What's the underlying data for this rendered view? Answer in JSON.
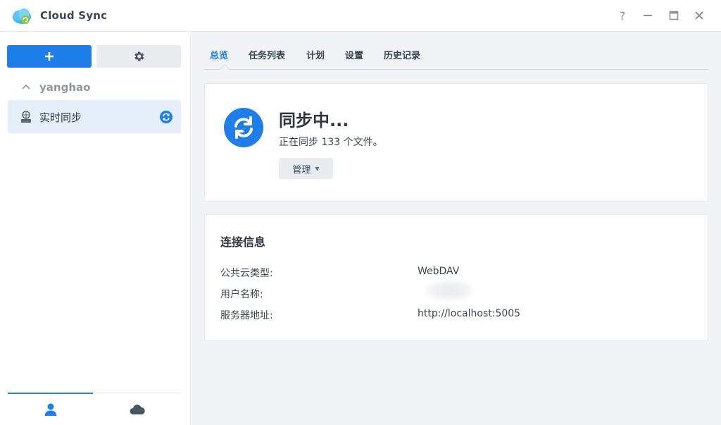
{
  "app": {
    "title": "Cloud Sync",
    "help_glyph": "?"
  },
  "sidebar": {
    "account_name": "yanghao",
    "task_label": "实时同步"
  },
  "tabs": [
    {
      "label": "总览",
      "active": true
    },
    {
      "label": "任务列表",
      "active": false
    },
    {
      "label": "计划",
      "active": false
    },
    {
      "label": "设置",
      "active": false
    },
    {
      "label": "历史记录",
      "active": false
    }
  ],
  "status": {
    "title": "同步中...",
    "description": "正在同步 133 个文件。",
    "manage_label": "管理"
  },
  "connection": {
    "title": "连接信息",
    "rows": [
      {
        "label": "公共云类型:",
        "value": "WebDAV"
      },
      {
        "label": "用户名称:",
        "value": ""
      },
      {
        "label": "服务器地址:",
        "value": "http://localhost:5005"
      }
    ]
  },
  "colors": {
    "accent": "#1f7ee8"
  }
}
